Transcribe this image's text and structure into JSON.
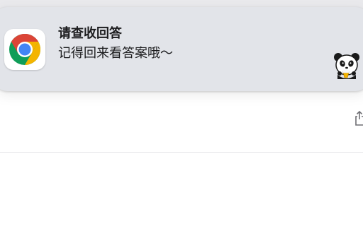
{
  "notification": {
    "app": "chrome",
    "title": "请查收回答",
    "body": "记得回来看答案哦～"
  },
  "icons": {
    "app_icon": "chrome-logo-icon",
    "attachment": "panda-sticker-icon",
    "share": "share-icon"
  },
  "colors": {
    "banner_bg": "#e2e4e9",
    "chrome_red": "#db4437",
    "chrome_yellow": "#f4b400",
    "chrome_green": "#0f9d58",
    "chrome_blue": "#4285f4"
  }
}
